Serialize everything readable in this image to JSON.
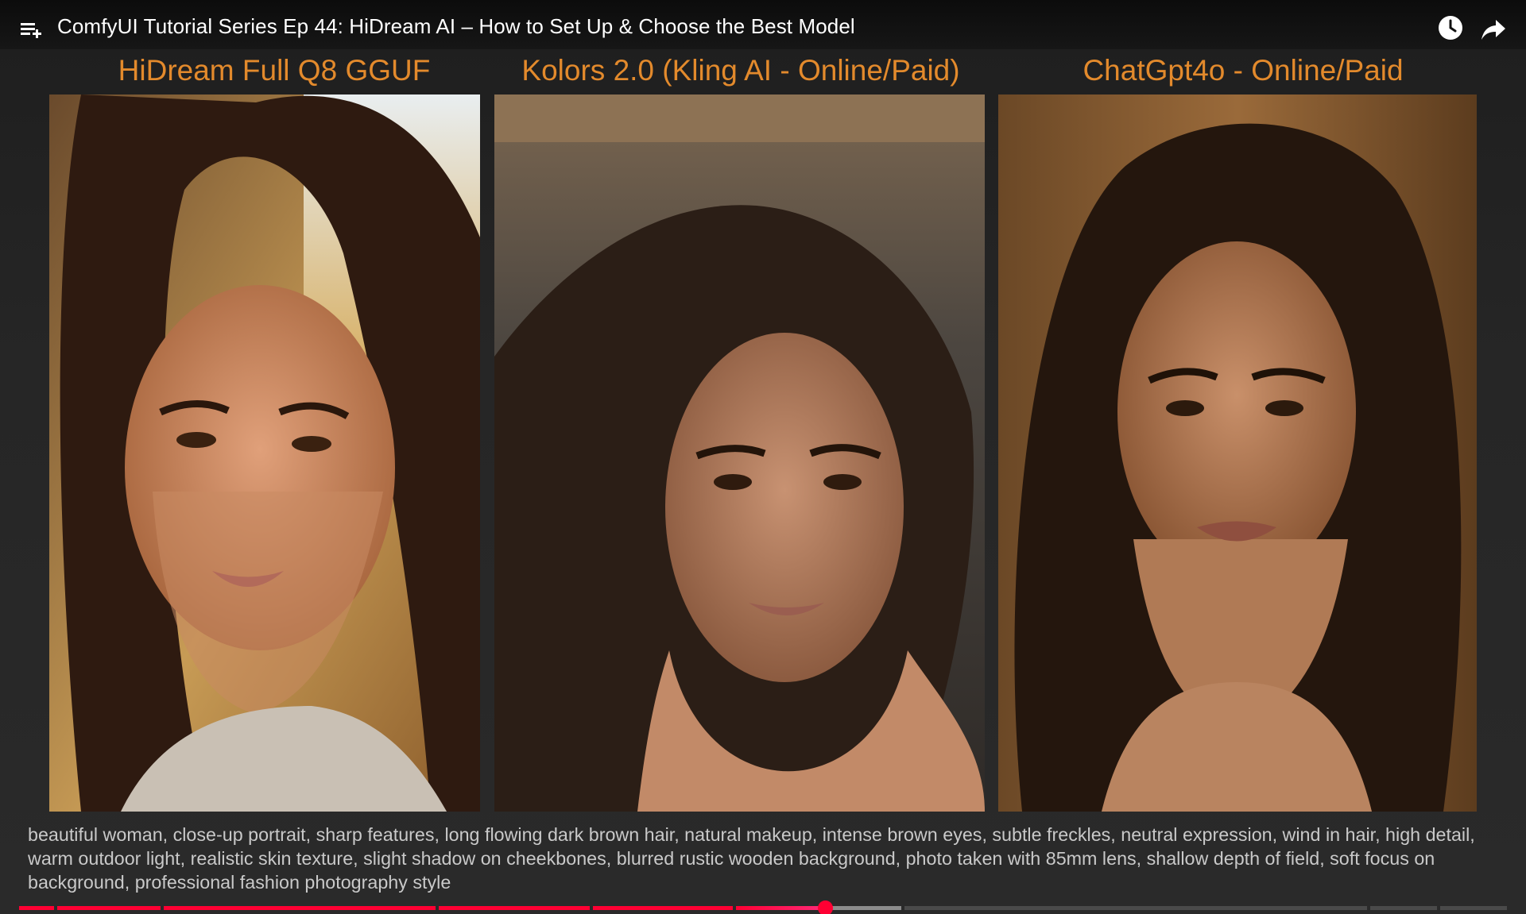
{
  "header": {
    "title": "ComfyUI Tutorial Series Ep 44: HiDream AI – How to Set Up & Choose the Best Model",
    "menu_icon": "playlist-icon",
    "watch_later_icon": "clock-icon",
    "share_icon": "share-arrow-icon"
  },
  "columns": [
    {
      "label": "HiDream Full Q8 GGUF"
    },
    {
      "label": "Kolors 2.0 (Kling AI - Online/Paid)"
    },
    {
      "label": "ChatGpt4o - Online/Paid"
    }
  ],
  "prompt_text": "beautiful woman, close-up portrait, sharp features, long flowing dark brown hair, natural makeup, intense brown eyes, subtle freckles, neutral expression, wind in hair, high detail, warm outdoor light, realistic skin texture, slight shadow on cheekbones, blurred rustic wooden background, photo taken with 85mm lens, shallow depth of field, soft focus on background, professional fashion photography style",
  "player": {
    "progress_fraction": 0.44,
    "accent_color": "#ff0033",
    "caption_color": "#e38a2c"
  }
}
